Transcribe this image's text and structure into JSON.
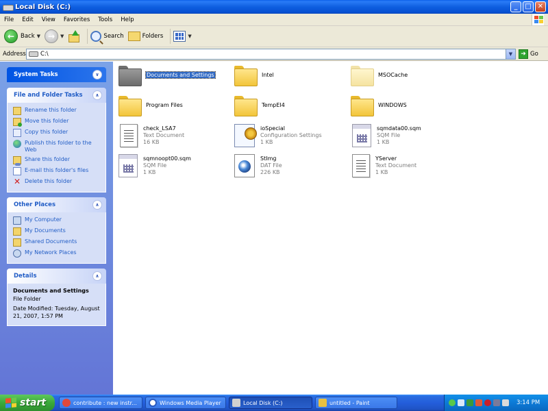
{
  "window": {
    "title": "Local Disk (C:)",
    "buttons": {
      "minimize": "_",
      "maximize": "□",
      "close": "✕"
    }
  },
  "menu": [
    "File",
    "Edit",
    "View",
    "Favorites",
    "Tools",
    "Help"
  ],
  "toolbar": {
    "back": "Back",
    "search": "Search",
    "folders": "Folders"
  },
  "address": {
    "label": "Address",
    "value": "C:\\",
    "go": "Go"
  },
  "sidebar": {
    "system_tasks": {
      "title": "System Tasks"
    },
    "file_folder_tasks": {
      "title": "File and Folder Tasks",
      "items": [
        {
          "label": "Rename this folder",
          "icon": "rename-icon"
        },
        {
          "label": "Move this folder",
          "icon": "move-icon"
        },
        {
          "label": "Copy this folder",
          "icon": "copy-icon"
        },
        {
          "label": "Publish this folder to the Web",
          "icon": "globe-icon"
        },
        {
          "label": "Share this folder",
          "icon": "share-icon"
        },
        {
          "label": "E-mail this folder's files",
          "icon": "email-icon"
        },
        {
          "label": "Delete this folder",
          "icon": "delete-icon"
        }
      ]
    },
    "other_places": {
      "title": "Other Places",
      "items": [
        {
          "label": "My Computer",
          "icon": "computer-icon"
        },
        {
          "label": "My Documents",
          "icon": "documents-icon"
        },
        {
          "label": "Shared Documents",
          "icon": "shared-folder-icon"
        },
        {
          "label": "My Network Places",
          "icon": "network-icon"
        }
      ]
    },
    "details": {
      "title": "Details",
      "name": "Documents and Settings",
      "type": "File Folder",
      "modified": "Date Modified: Tuesday, August 21, 2007, 1:57 PM"
    }
  },
  "files": [
    {
      "name": "Documents and Settings",
      "kind": "folder-gray",
      "selected": true
    },
    {
      "name": "Intel",
      "kind": "folder"
    },
    {
      "name": "MSOCache",
      "kind": "folder-faded"
    },
    {
      "name": "Program Files",
      "kind": "folder"
    },
    {
      "name": "TempEI4",
      "kind": "folder"
    },
    {
      "name": "WINDOWS",
      "kind": "folder"
    },
    {
      "name": "check_LSA7",
      "type": "Text Document",
      "size": "16 KB",
      "kind": "text"
    },
    {
      "name": "ioSpecial",
      "type": "Configuration Settings",
      "size": "1 KB",
      "kind": "config"
    },
    {
      "name": "sqmdata00.sqm",
      "type": "SQM File",
      "size": "1 KB",
      "kind": "sqm"
    },
    {
      "name": "sqmnoopt00.sqm",
      "type": "SQM File",
      "size": "1 KB",
      "kind": "sqm"
    },
    {
      "name": "StImɡ",
      "type": "DAT File",
      "size": "226 KB",
      "kind": "dat"
    },
    {
      "name": "YServer",
      "type": "Text Document",
      "size": "1 KB",
      "kind": "text"
    }
  ],
  "taskbar": {
    "start": "start",
    "tasks": [
      {
        "label": "contribute : new instr...",
        "active": false
      },
      {
        "label": "Windows Media Player",
        "active": false
      },
      {
        "label": "Local Disk (C:)",
        "active": true
      },
      {
        "label": "untitled - Paint",
        "active": false
      }
    ],
    "clock": "3:14 PM"
  },
  "colors": {
    "titlebar": "#0a5ee8",
    "taskpane": "#7ba2e7",
    "selection": "#316ac5",
    "start": "#3aa93a"
  }
}
